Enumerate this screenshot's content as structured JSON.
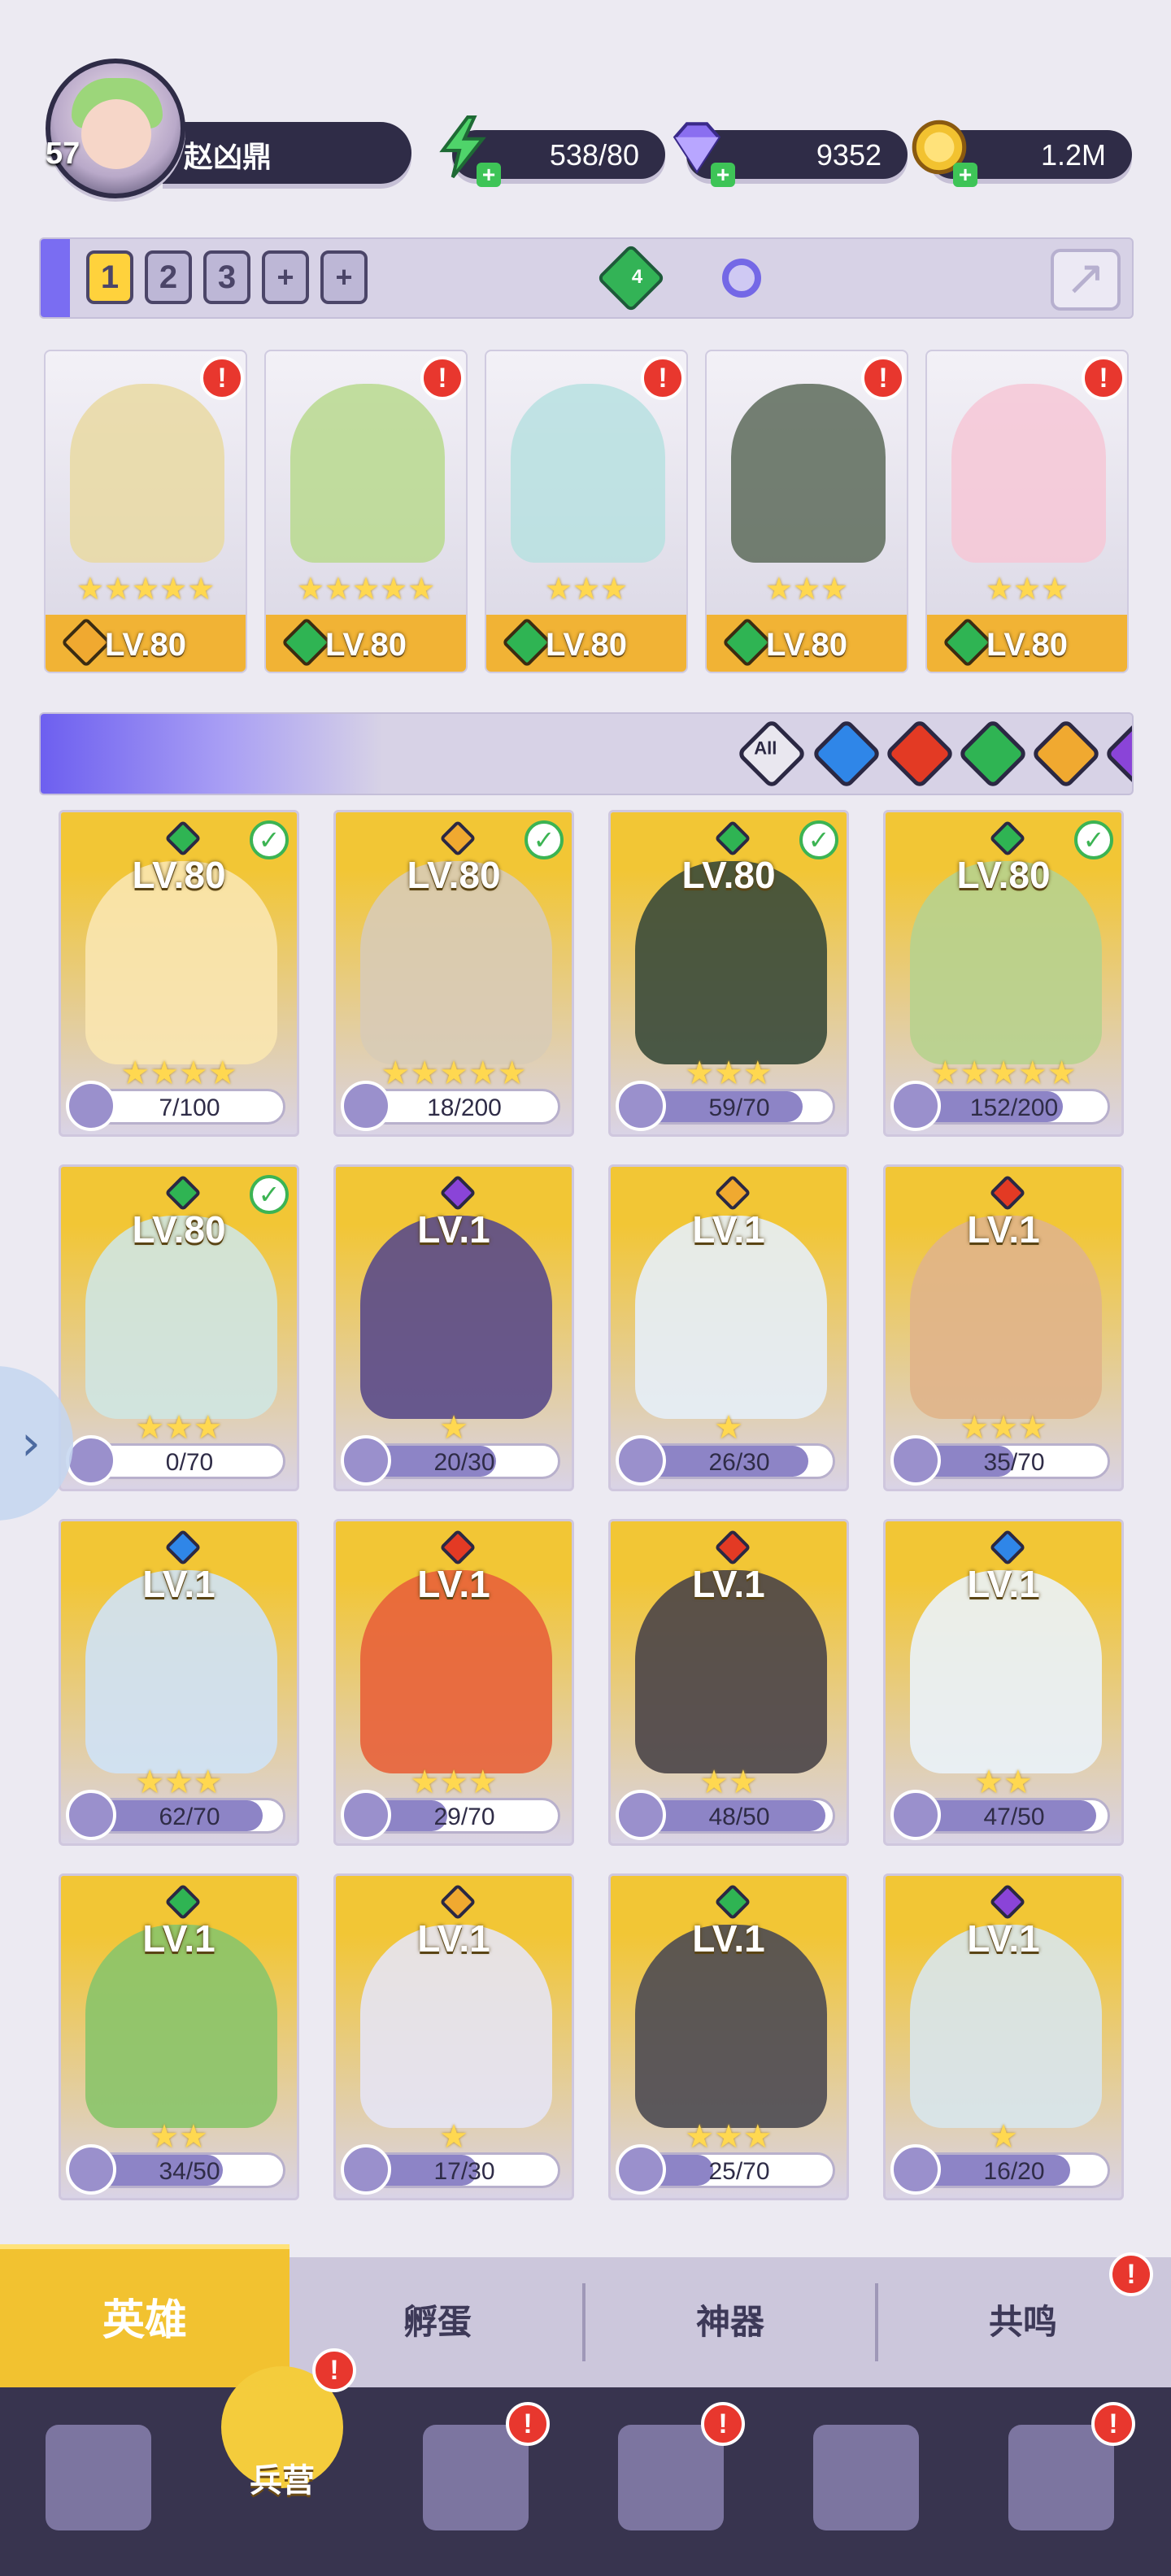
{
  "player": {
    "level": "57",
    "name": "赵凶鼎"
  },
  "resources": [
    {
      "name": "energy",
      "icon": "lightning-icon",
      "value": "538/80",
      "color": "#4fd46a"
    },
    {
      "name": "diamond",
      "icon": "diamond-icon",
      "value": "9352",
      "color": "#8a6ff0"
    },
    {
      "name": "gold",
      "icon": "gold-coin-icon",
      "value": "1.2M",
      "color": "#f2c230"
    }
  ],
  "team_tabs": [
    "1",
    "2",
    "3",
    "+",
    "+"
  ],
  "team_power_badge": "4",
  "team": [
    {
      "level": "LV.80",
      "stars": 5,
      "element": "light",
      "alert": "!"
    },
    {
      "level": "LV.80",
      "stars": 5,
      "element": "nature",
      "alert": "!"
    },
    {
      "level": "LV.80",
      "stars": 3,
      "element": "nature",
      "alert": "!"
    },
    {
      "level": "LV.80",
      "stars": 3,
      "element": "nature",
      "alert": "!"
    },
    {
      "level": "LV.80",
      "stars": 3,
      "element": "nature",
      "alert": "!"
    }
  ],
  "filter": {
    "all_label": "All",
    "elements": [
      "water",
      "fire",
      "nature",
      "light",
      "dark"
    ]
  },
  "element_colors": {
    "water": "#2f86e8",
    "fire": "#e33a24",
    "nature": "#2fb453",
    "light": "#f0a930",
    "dark": "#8a44d8"
  },
  "heroes": [
    {
      "level": "LV.80",
      "element": "nature",
      "checked": true,
      "stars": 4,
      "progress": "7/100",
      "frac": 0.07
    },
    {
      "level": "LV.80",
      "element": "light",
      "checked": true,
      "stars": 5,
      "progress": "18/200",
      "frac": 0.09
    },
    {
      "level": "LV.80",
      "element": "nature",
      "checked": true,
      "stars": 3,
      "progress": "59/70",
      "frac": 0.84
    },
    {
      "level": "LV.80",
      "element": "nature",
      "checked": true,
      "stars": 5,
      "progress": "152/200",
      "frac": 0.76
    },
    {
      "level": "LV.80",
      "element": "nature",
      "checked": true,
      "stars": 3,
      "progress": "0/70",
      "frac": 0.0
    },
    {
      "level": "LV.1",
      "element": "dark",
      "checked": false,
      "stars": 1,
      "progress": "20/30",
      "frac": 0.67
    },
    {
      "level": "LV.1",
      "element": "light",
      "checked": false,
      "stars": 1,
      "progress": "26/30",
      "frac": 0.87
    },
    {
      "level": "LV.1",
      "element": "fire",
      "checked": false,
      "stars": 3,
      "progress": "35/70",
      "frac": 0.5
    },
    {
      "level": "LV.1",
      "element": "water",
      "checked": false,
      "stars": 3,
      "progress": "62/70",
      "frac": 0.89
    },
    {
      "level": "LV.1",
      "element": "fire",
      "checked": false,
      "stars": 3,
      "progress": "29/70",
      "frac": 0.41
    },
    {
      "level": "LV.1",
      "element": "fire",
      "checked": false,
      "stars": 2,
      "progress": "48/50",
      "frac": 0.96
    },
    {
      "level": "LV.1",
      "element": "water",
      "checked": false,
      "stars": 2,
      "progress": "47/50",
      "frac": 0.94
    },
    {
      "level": "LV.1",
      "element": "nature",
      "checked": false,
      "stars": 2,
      "progress": "34/50",
      "frac": 0.68
    },
    {
      "level": "LV.1",
      "element": "light",
      "checked": false,
      "stars": 1,
      "progress": "17/30",
      "frac": 0.57
    },
    {
      "level": "LV.1",
      "element": "nature",
      "checked": false,
      "stars": 3,
      "progress": "25/70",
      "frac": 0.36
    },
    {
      "level": "LV.1",
      "element": "dark",
      "checked": false,
      "stars": 1,
      "progress": "16/20",
      "frac": 0.8
    }
  ],
  "subtabs": [
    {
      "label": "英雄",
      "active": true,
      "alert": ""
    },
    {
      "label": "孵蛋",
      "active": false,
      "alert": ""
    },
    {
      "label": "神器",
      "active": false,
      "alert": ""
    },
    {
      "label": "共鸣",
      "active": false,
      "alert": "!"
    }
  ],
  "nav": [
    {
      "icon": "cards-icon",
      "label": "",
      "active": false,
      "alert": ""
    },
    {
      "icon": "barracks-icon",
      "label": "兵营",
      "active": true,
      "alert": "!"
    },
    {
      "icon": "map-book-icon",
      "label": "",
      "active": false,
      "alert": "!"
    },
    {
      "icon": "castle-icon",
      "label": "",
      "active": false,
      "alert": "!"
    },
    {
      "icon": "mushroom-house-icon",
      "label": "",
      "active": false,
      "alert": ""
    },
    {
      "icon": "guild-banner-icon",
      "label": "",
      "active": false,
      "alert": "!"
    }
  ]
}
